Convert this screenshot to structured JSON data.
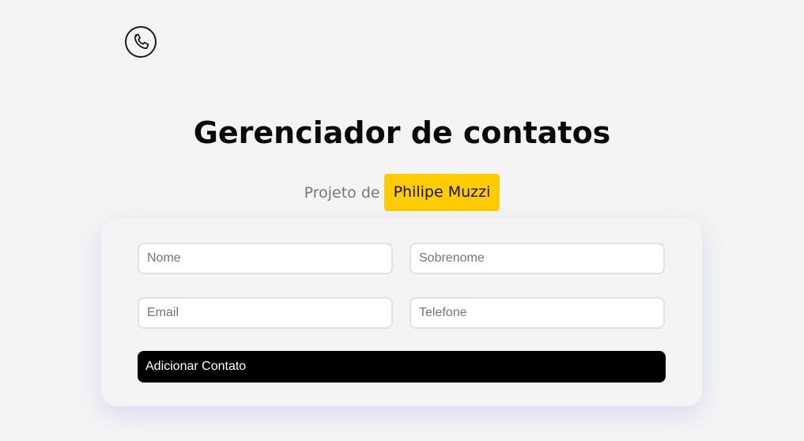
{
  "header": {
    "logo_icon": "phone-icon"
  },
  "page": {
    "title": "Gerenciador de contatos",
    "subtitle_prefix": "Projeto de",
    "author": "Philipe Muzzi",
    "accent_color": "#ffcc00"
  },
  "form": {
    "first_name": {
      "placeholder": "Nome",
      "value": ""
    },
    "last_name": {
      "placeholder": "Sobrenome",
      "value": ""
    },
    "email": {
      "placeholder": "Email",
      "value": ""
    },
    "phone": {
      "placeholder": "Telefone",
      "value": ""
    },
    "submit_label": "Adicionar Contato"
  }
}
